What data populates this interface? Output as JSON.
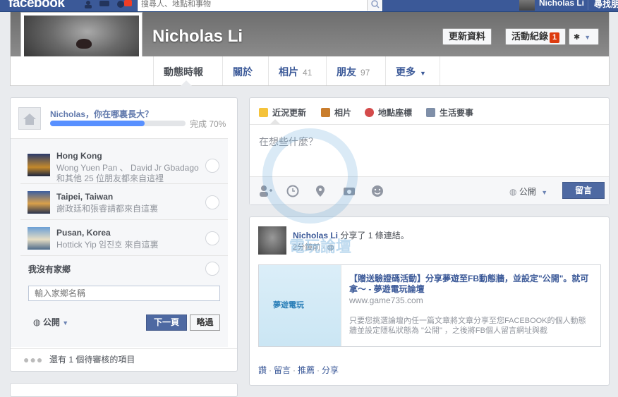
{
  "topbar": {
    "logo": "facebook",
    "search_placeholder": "搜尋人、地點和事物",
    "user_name": "Nicholas Li",
    "find_friends": "尋找朋友"
  },
  "profile": {
    "name": "Nicholas Li",
    "update_info": "更新資料",
    "activity_log": "活動紀錄",
    "activity_count": "1",
    "tabs": [
      {
        "label": "動態時報",
        "count": ""
      },
      {
        "label": "關於",
        "count": ""
      },
      {
        "label": "相片",
        "count": "41"
      },
      {
        "label": "朋友",
        "count": "97"
      },
      {
        "label": "更多",
        "count": ""
      }
    ]
  },
  "hometown": {
    "question": "Nicholas，你在哪裏長大？",
    "progress_label": "完成 70%",
    "progress": 0.7,
    "options": [
      {
        "name": "Hong Kong",
        "sub1": "Wong Yuen Pan 、 David Jr Gbadago",
        "sub2": "和其他 25 位朋友都來自這裡"
      },
      {
        "name": "Taipei, Taiwan",
        "sub1": "謝政廷和張睿請都來自這裏",
        "sub2": ""
      },
      {
        "name": "Pusan, Korea",
        "sub1": "Hottick Yip 임진호 來自這裏",
        "sub2": ""
      }
    ],
    "no_hometown": "我沒有家鄉",
    "input_placeholder": "輸入家鄉名稱",
    "privacy": "公開",
    "next": "下一頁",
    "skip": "略過",
    "pending": "還有 1 個待審核的項目"
  },
  "composer": {
    "tabs": [
      "近況更新",
      "相片",
      "地點座標",
      "生活要事"
    ],
    "placeholder": "在想些什麼？",
    "privacy": "公開",
    "post": "留言"
  },
  "story": {
    "name": "Nicholas Li",
    "action": "分享了 1 條連結。",
    "time": "2分鐘前",
    "link_title": "【贈送驗證碼活動】分享夢遊至FB動態牆，並設定\"公開\"。就可拿～ - 夢遊電玩論壇",
    "link_url": "www.game735.com",
    "link_desc": "只要您挑選論壇內任一篇文章將文章分享至您FACEBOOK的個人動態牆並設定隱私狀態為 \"公開\" ，之後將FB個人留言網址與截",
    "link_image_text": "夢遊電玩",
    "actions": [
      "讚",
      "留言",
      "推薦",
      "分享"
    ]
  },
  "watermark": {
    "text": "電玩論壇"
  }
}
